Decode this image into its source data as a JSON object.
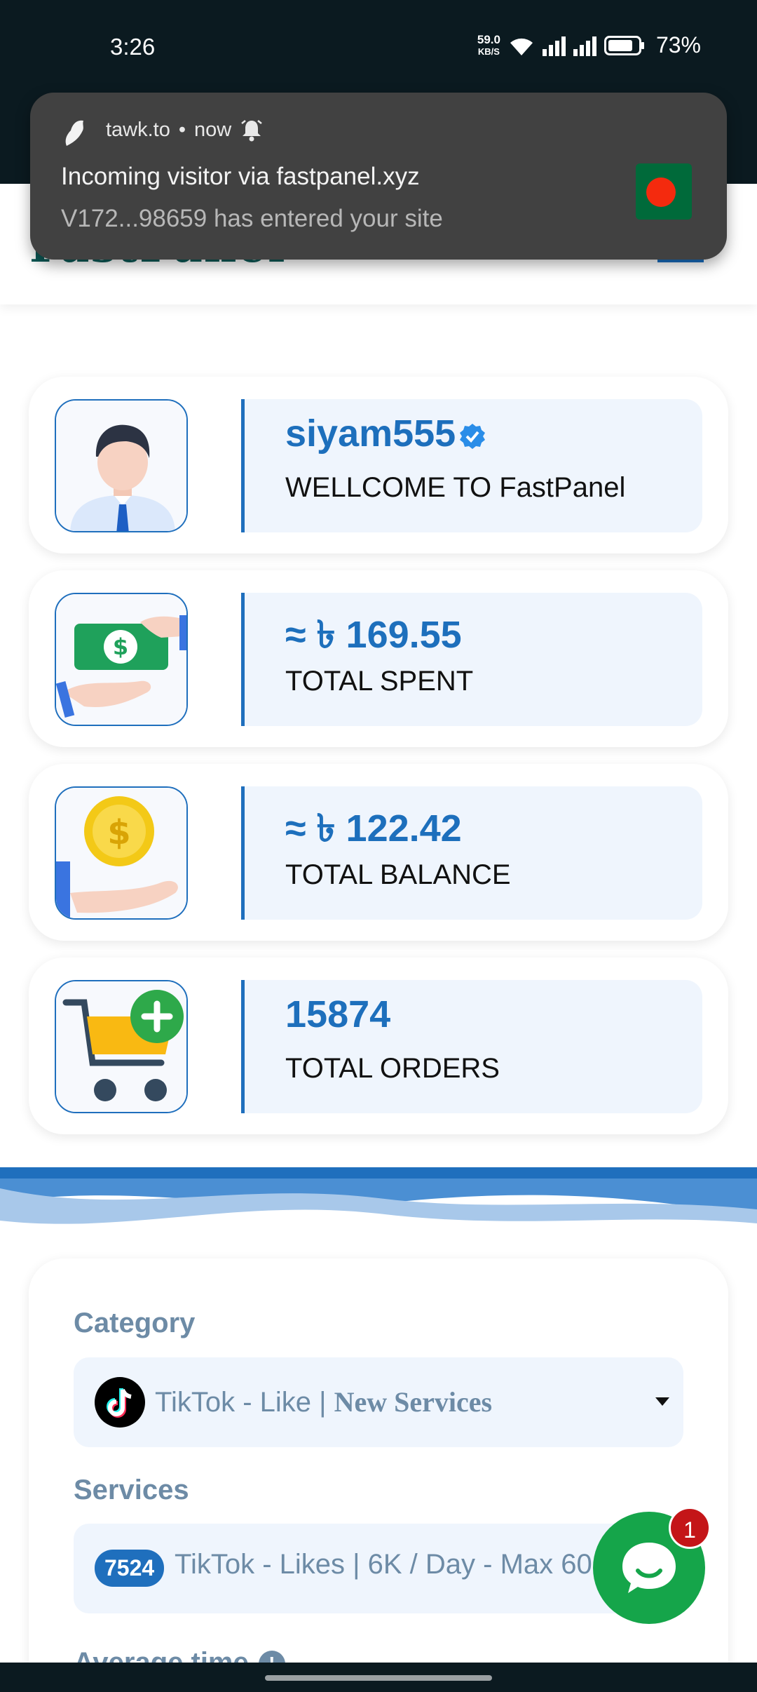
{
  "status_bar": {
    "time": "3:26",
    "net_speed_value": "59.0",
    "net_speed_unit": "KB/S",
    "battery": "73%",
    "icons": [
      "wifi-icon",
      "signal-icon",
      "signal-icon",
      "battery-icon"
    ]
  },
  "notification": {
    "app": "tawk.to",
    "separator": "•",
    "time": "now",
    "title": "Incoming visitor via fastpanel.xyz",
    "body": "V172...98659 has entered your site",
    "icons": [
      "tawk-icon",
      "bell-icon",
      "bangladesh-flag-icon"
    ]
  },
  "stats": [
    {
      "value": "siyam555",
      "label": "WELLCOME TO FastPanel",
      "icon": "user-avatar-icon",
      "verified": true
    },
    {
      "value": "≈ ৳ 169.55",
      "label": "TOTAL SPENT",
      "icon": "money-hand-icon"
    },
    {
      "value": "≈ ৳ 122.42",
      "label": "TOTAL BALANCE",
      "icon": "coin-hand-icon"
    },
    {
      "value": "15874",
      "label": "TOTAL ORDERS",
      "icon": "cart-add-icon"
    }
  ],
  "order_form": {
    "category_label": "Category",
    "category_value_plain": "TikTok - Like | ",
    "category_value_bold": "New Services",
    "services_label": "Services",
    "service_id": "7524",
    "service_value": "TikTok - Likes | 6K / Day - Max 60",
    "avg_time_label": "Average time"
  },
  "chat": {
    "badge": "1",
    "icon": "chat-bubble-icon"
  },
  "colors": {
    "primary": "#1f6fbd",
    "muted": "#6d8ba6",
    "chat": "#15a54a",
    "badge": "#c41518"
  }
}
